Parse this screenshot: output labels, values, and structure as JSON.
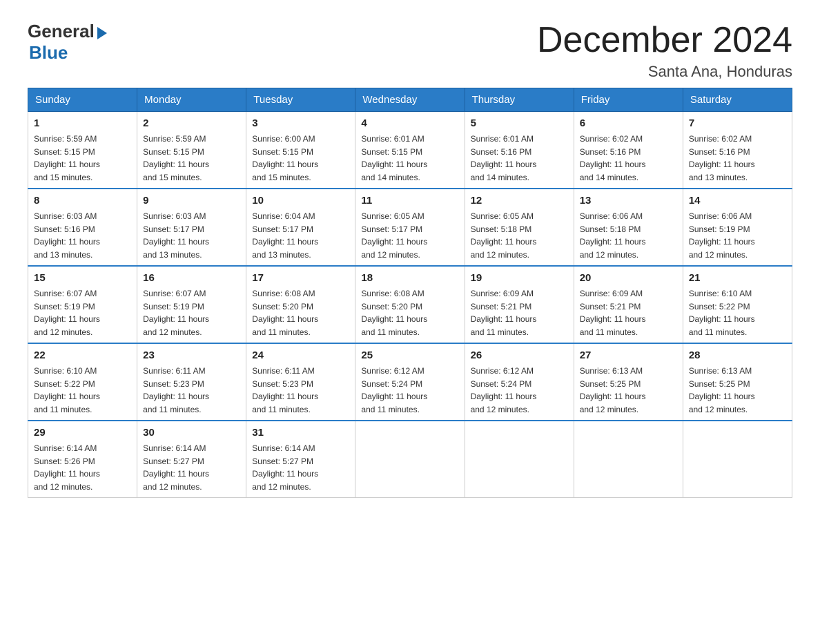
{
  "logo": {
    "general": "General",
    "blue": "Blue"
  },
  "title": "December 2024",
  "subtitle": "Santa Ana, Honduras",
  "days_of_week": [
    "Sunday",
    "Monday",
    "Tuesday",
    "Wednesday",
    "Thursday",
    "Friday",
    "Saturday"
  ],
  "weeks": [
    [
      {
        "day": "1",
        "sunrise": "5:59 AM",
        "sunset": "5:15 PM",
        "daylight": "11 hours and 15 minutes."
      },
      {
        "day": "2",
        "sunrise": "5:59 AM",
        "sunset": "5:15 PM",
        "daylight": "11 hours and 15 minutes."
      },
      {
        "day": "3",
        "sunrise": "6:00 AM",
        "sunset": "5:15 PM",
        "daylight": "11 hours and 15 minutes."
      },
      {
        "day": "4",
        "sunrise": "6:01 AM",
        "sunset": "5:15 PM",
        "daylight": "11 hours and 14 minutes."
      },
      {
        "day": "5",
        "sunrise": "6:01 AM",
        "sunset": "5:16 PM",
        "daylight": "11 hours and 14 minutes."
      },
      {
        "day": "6",
        "sunrise": "6:02 AM",
        "sunset": "5:16 PM",
        "daylight": "11 hours and 14 minutes."
      },
      {
        "day": "7",
        "sunrise": "6:02 AM",
        "sunset": "5:16 PM",
        "daylight": "11 hours and 13 minutes."
      }
    ],
    [
      {
        "day": "8",
        "sunrise": "6:03 AM",
        "sunset": "5:16 PM",
        "daylight": "11 hours and 13 minutes."
      },
      {
        "day": "9",
        "sunrise": "6:03 AM",
        "sunset": "5:17 PM",
        "daylight": "11 hours and 13 minutes."
      },
      {
        "day": "10",
        "sunrise": "6:04 AM",
        "sunset": "5:17 PM",
        "daylight": "11 hours and 13 minutes."
      },
      {
        "day": "11",
        "sunrise": "6:05 AM",
        "sunset": "5:17 PM",
        "daylight": "11 hours and 12 minutes."
      },
      {
        "day": "12",
        "sunrise": "6:05 AM",
        "sunset": "5:18 PM",
        "daylight": "11 hours and 12 minutes."
      },
      {
        "day": "13",
        "sunrise": "6:06 AM",
        "sunset": "5:18 PM",
        "daylight": "11 hours and 12 minutes."
      },
      {
        "day": "14",
        "sunrise": "6:06 AM",
        "sunset": "5:19 PM",
        "daylight": "11 hours and 12 minutes."
      }
    ],
    [
      {
        "day": "15",
        "sunrise": "6:07 AM",
        "sunset": "5:19 PM",
        "daylight": "11 hours and 12 minutes."
      },
      {
        "day": "16",
        "sunrise": "6:07 AM",
        "sunset": "5:19 PM",
        "daylight": "11 hours and 12 minutes."
      },
      {
        "day": "17",
        "sunrise": "6:08 AM",
        "sunset": "5:20 PM",
        "daylight": "11 hours and 11 minutes."
      },
      {
        "day": "18",
        "sunrise": "6:08 AM",
        "sunset": "5:20 PM",
        "daylight": "11 hours and 11 minutes."
      },
      {
        "day": "19",
        "sunrise": "6:09 AM",
        "sunset": "5:21 PM",
        "daylight": "11 hours and 11 minutes."
      },
      {
        "day": "20",
        "sunrise": "6:09 AM",
        "sunset": "5:21 PM",
        "daylight": "11 hours and 11 minutes."
      },
      {
        "day": "21",
        "sunrise": "6:10 AM",
        "sunset": "5:22 PM",
        "daylight": "11 hours and 11 minutes."
      }
    ],
    [
      {
        "day": "22",
        "sunrise": "6:10 AM",
        "sunset": "5:22 PM",
        "daylight": "11 hours and 11 minutes."
      },
      {
        "day": "23",
        "sunrise": "6:11 AM",
        "sunset": "5:23 PM",
        "daylight": "11 hours and 11 minutes."
      },
      {
        "day": "24",
        "sunrise": "6:11 AM",
        "sunset": "5:23 PM",
        "daylight": "11 hours and 11 minutes."
      },
      {
        "day": "25",
        "sunrise": "6:12 AM",
        "sunset": "5:24 PM",
        "daylight": "11 hours and 11 minutes."
      },
      {
        "day": "26",
        "sunrise": "6:12 AM",
        "sunset": "5:24 PM",
        "daylight": "11 hours and 12 minutes."
      },
      {
        "day": "27",
        "sunrise": "6:13 AM",
        "sunset": "5:25 PM",
        "daylight": "11 hours and 12 minutes."
      },
      {
        "day": "28",
        "sunrise": "6:13 AM",
        "sunset": "5:25 PM",
        "daylight": "11 hours and 12 minutes."
      }
    ],
    [
      {
        "day": "29",
        "sunrise": "6:14 AM",
        "sunset": "5:26 PM",
        "daylight": "11 hours and 12 minutes."
      },
      {
        "day": "30",
        "sunrise": "6:14 AM",
        "sunset": "5:27 PM",
        "daylight": "11 hours and 12 minutes."
      },
      {
        "day": "31",
        "sunrise": "6:14 AM",
        "sunset": "5:27 PM",
        "daylight": "11 hours and 12 minutes."
      },
      null,
      null,
      null,
      null
    ]
  ],
  "labels": {
    "sunrise": "Sunrise:",
    "sunset": "Sunset:",
    "daylight": "Daylight:"
  }
}
